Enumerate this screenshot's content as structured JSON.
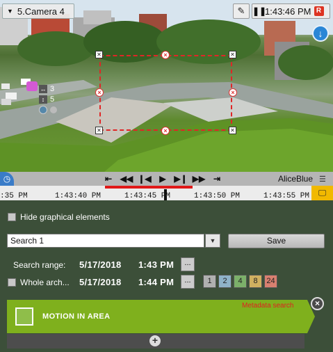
{
  "camera": {
    "name": "5.Camera 4",
    "time": "1:43:46 PM",
    "rec_badge": "R",
    "download_icon": "download-arrow-icon",
    "doc_icon": "edit-document-icon"
  },
  "zone_overlay": {
    "color": "#e02626",
    "mini_counts": {
      "width": "3",
      "height": "5"
    }
  },
  "playback": {
    "range_name": "AliceBlue",
    "controls": [
      "go-start-icon",
      "fast-rewind-icon",
      "step-back-icon",
      "play-icon",
      "step-forward-icon",
      "fast-forward-icon",
      "go-end-icon"
    ]
  },
  "timeline": {
    "ticks": [
      ":35 PM",
      "1:43:40 PM",
      "1:43:45 PM",
      "1:43:50 PM",
      "1:43:55 PM"
    ]
  },
  "options": {
    "hide_graphical_label": "Hide graphical elements",
    "search_select_value": "Search 1",
    "save_label": "Save",
    "search_range_label": "Search range:",
    "start_date": "5/17/2018",
    "start_time": "1:43 PM",
    "whole_archive_label": "Whole arch...",
    "end_date": "5/17/2018",
    "end_time": "1:44 PM",
    "picker_label": "...",
    "intervals": [
      "1",
      "2",
      "4",
      "8",
      "24"
    ],
    "interval_colors": [
      "#b0b0b0",
      "#8fb2c8",
      "#7cb06a",
      "#d0b060",
      "#d98070"
    ]
  },
  "condition": {
    "title": "MOTION IN AREA",
    "metadata_label": "Metadata search",
    "close_label": "×",
    "add_label": "+"
  }
}
